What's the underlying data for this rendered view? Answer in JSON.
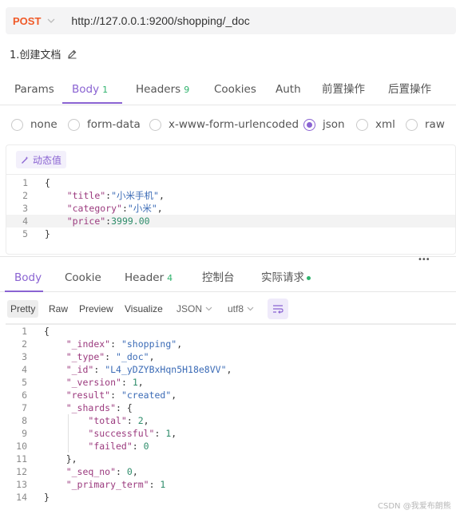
{
  "request": {
    "method": "POST",
    "url": "http://127.0.0.1:9200/shopping/_doc",
    "doc_name": "1.创建文档"
  },
  "req_tabs": [
    {
      "label": "Params",
      "count": ""
    },
    {
      "label": "Body",
      "count": "1"
    },
    {
      "label": "Headers",
      "count": "9"
    },
    {
      "label": "Cookies",
      "count": ""
    },
    {
      "label": "Auth",
      "count": ""
    },
    {
      "label": "前置操作",
      "count": ""
    },
    {
      "label": "后置操作",
      "count": ""
    }
  ],
  "body_types": [
    "none",
    "form-data",
    "x-www-form-urlencoded",
    "json",
    "xml",
    "raw"
  ],
  "selected_body_type": "json",
  "dynamic_value_label": "动态值",
  "request_body": [
    {
      "ln": "1",
      "parts": [
        [
          "p",
          "{"
        ]
      ]
    },
    {
      "ln": "2",
      "parts": [
        [
          "p",
          "    "
        ],
        [
          "k",
          "\"title\""
        ],
        [
          "p",
          ":"
        ],
        [
          "s",
          "\"小米手机\""
        ],
        [
          "p",
          ","
        ]
      ]
    },
    {
      "ln": "3",
      "parts": [
        [
          "p",
          "    "
        ],
        [
          "k",
          "\"category\""
        ],
        [
          "p",
          ":"
        ],
        [
          "s",
          "\"小米\""
        ],
        [
          "p",
          ","
        ]
      ]
    },
    {
      "ln": "4",
      "parts": [
        [
          "p",
          "    "
        ],
        [
          "k",
          "\"price\""
        ],
        [
          "p",
          ":"
        ],
        [
          "n",
          "3999.00"
        ]
      ]
    },
    {
      "ln": "5",
      "parts": [
        [
          "p",
          "}"
        ]
      ]
    }
  ],
  "resp_tabs": [
    {
      "label": "Body",
      "count": ""
    },
    {
      "label": "Cookie",
      "count": ""
    },
    {
      "label": "Header",
      "count": "4"
    },
    {
      "label": "控制台",
      "count": ""
    },
    {
      "label": "实际请求",
      "count": ""
    }
  ],
  "format_buttons": [
    "Pretty",
    "Raw",
    "Preview",
    "Visualize"
  ],
  "format_select": "JSON",
  "encoding_select": "utf8",
  "response_body": [
    {
      "ln": "1",
      "parts": [
        [
          "p",
          "{"
        ]
      ]
    },
    {
      "ln": "2",
      "parts": [
        [
          "p",
          "    "
        ],
        [
          "k",
          "\"_index\""
        ],
        [
          "p",
          ": "
        ],
        [
          "s",
          "\"shopping\""
        ],
        [
          "p",
          ","
        ]
      ]
    },
    {
      "ln": "3",
      "parts": [
        [
          "p",
          "    "
        ],
        [
          "k",
          "\"_type\""
        ],
        [
          "p",
          ": "
        ],
        [
          "s",
          "\"_doc\""
        ],
        [
          "p",
          ","
        ]
      ]
    },
    {
      "ln": "4",
      "parts": [
        [
          "p",
          "    "
        ],
        [
          "k",
          "\"_id\""
        ],
        [
          "p",
          ": "
        ],
        [
          "s",
          "\"L4_yDZYBxHqn5H18e8VV\""
        ],
        [
          "p",
          ","
        ]
      ]
    },
    {
      "ln": "5",
      "parts": [
        [
          "p",
          "    "
        ],
        [
          "k",
          "\"_version\""
        ],
        [
          "p",
          ": "
        ],
        [
          "n",
          "1"
        ],
        [
          "p",
          ","
        ]
      ]
    },
    {
      "ln": "6",
      "parts": [
        [
          "p",
          "    "
        ],
        [
          "k",
          "\"result\""
        ],
        [
          "p",
          ": "
        ],
        [
          "s",
          "\"created\""
        ],
        [
          "p",
          ","
        ]
      ]
    },
    {
      "ln": "7",
      "parts": [
        [
          "p",
          "    "
        ],
        [
          "k",
          "\"_shards\""
        ],
        [
          "p",
          ": {"
        ]
      ]
    },
    {
      "ln": "8",
      "parts": [
        [
          "p",
          "        "
        ],
        [
          "k",
          "\"total\""
        ],
        [
          "p",
          ": "
        ],
        [
          "n",
          "2"
        ],
        [
          "p",
          ","
        ]
      ]
    },
    {
      "ln": "9",
      "parts": [
        [
          "p",
          "        "
        ],
        [
          "k",
          "\"successful\""
        ],
        [
          "p",
          ": "
        ],
        [
          "n",
          "1"
        ],
        [
          "p",
          ","
        ]
      ]
    },
    {
      "ln": "10",
      "parts": [
        [
          "p",
          "        "
        ],
        [
          "k",
          "\"failed\""
        ],
        [
          "p",
          ": "
        ],
        [
          "n",
          "0"
        ]
      ]
    },
    {
      "ln": "11",
      "parts": [
        [
          "p",
          "    },"
        ]
      ]
    },
    {
      "ln": "12",
      "parts": [
        [
          "p",
          "    "
        ],
        [
          "k",
          "\"_seq_no\""
        ],
        [
          "p",
          ": "
        ],
        [
          "n",
          "0"
        ],
        [
          "p",
          ","
        ]
      ]
    },
    {
      "ln": "13",
      "parts": [
        [
          "p",
          "    "
        ],
        [
          "k",
          "\"_primary_term\""
        ],
        [
          "p",
          ": "
        ],
        [
          "n",
          "1"
        ]
      ]
    },
    {
      "ln": "14",
      "parts": [
        [
          "p",
          "}"
        ]
      ]
    }
  ],
  "watermark": "CSDN @我爱布朗熊",
  "colors": {
    "accent": "#8a63d2",
    "method": "#f05a28",
    "count": "#2fb36d"
  }
}
